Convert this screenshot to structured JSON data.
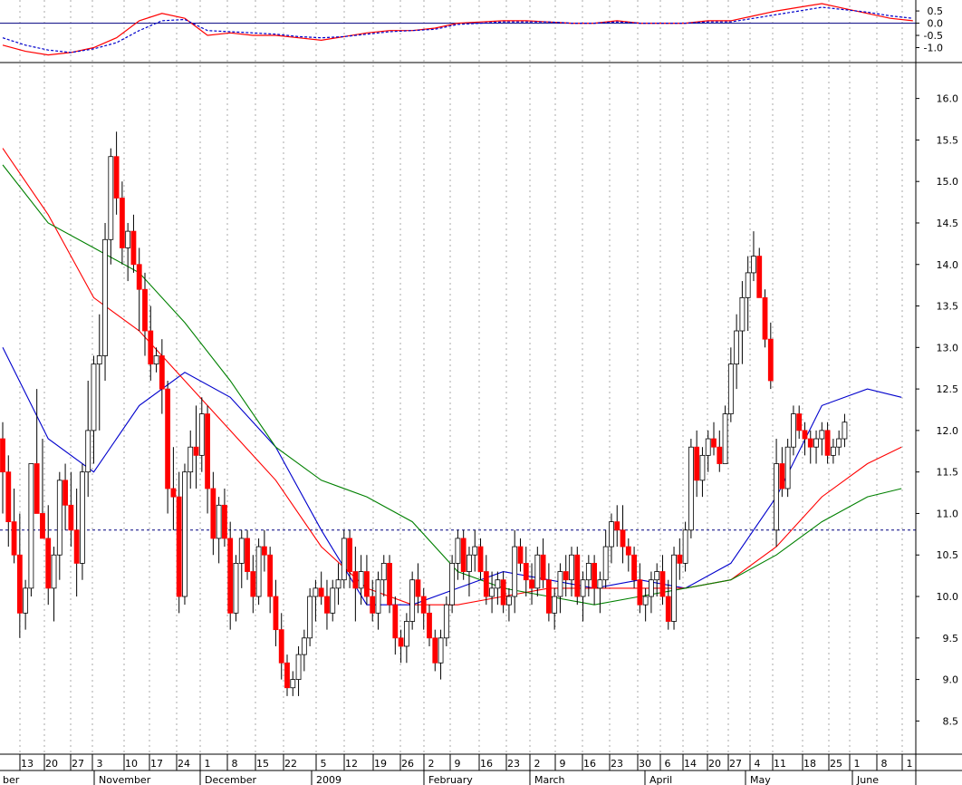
{
  "chart_data": [
    {
      "type": "line",
      "panel": "oscillator",
      "ylim": [
        -1.5,
        0.8
      ],
      "y_ticks": [
        "0.5",
        "0.0",
        "-0.5",
        "-1.0"
      ],
      "zero_line": 0.0,
      "grid": "vertical dotted, one line per week",
      "series": [
        {
          "color": "#ff0000",
          "style": "solid",
          "x": [
            0,
            4,
            8,
            12,
            16,
            20,
            24,
            28,
            32,
            36,
            40,
            44,
            48,
            52,
            56,
            60,
            64,
            68,
            72,
            76,
            80,
            84,
            88,
            92,
            96,
            100,
            104,
            108,
            112,
            116,
            120,
            124,
            128,
            132,
            136,
            140,
            144,
            148,
            152,
            156,
            160
          ],
          "values": [
            -0.9,
            -1.15,
            -1.3,
            -1.2,
            -1.0,
            -0.6,
            0.1,
            0.4,
            0.2,
            -0.5,
            -0.4,
            -0.5,
            -0.5,
            -0.6,
            -0.7,
            -0.55,
            -0.4,
            -0.3,
            -0.3,
            -0.2,
            0.0,
            0.05,
            0.1,
            0.1,
            0.05,
            0.0,
            0.0,
            0.1,
            0.0,
            0.0,
            0.0,
            0.1,
            0.1,
            0.3,
            0.5,
            0.65,
            0.8,
            0.6,
            0.4,
            0.2,
            0.1
          ]
        },
        {
          "color": "#0000cc",
          "style": "dashed",
          "x": [
            0,
            4,
            8,
            12,
            16,
            20,
            24,
            28,
            32,
            36,
            40,
            44,
            48,
            52,
            56,
            60,
            64,
            68,
            72,
            76,
            80,
            84,
            88,
            92,
            96,
            100,
            104,
            108,
            112,
            116,
            120,
            124,
            128,
            132,
            136,
            140,
            144,
            148,
            152,
            156,
            160
          ],
          "values": [
            -0.6,
            -0.9,
            -1.1,
            -1.2,
            -1.05,
            -0.8,
            -0.3,
            0.1,
            0.15,
            -0.3,
            -0.35,
            -0.4,
            -0.45,
            -0.55,
            -0.6,
            -0.55,
            -0.45,
            -0.35,
            -0.3,
            -0.25,
            -0.05,
            0.0,
            0.05,
            0.05,
            0.05,
            0.0,
            0.0,
            0.05,
            0.0,
            0.0,
            0.0,
            0.05,
            0.05,
            0.2,
            0.35,
            0.5,
            0.65,
            0.55,
            0.45,
            0.3,
            0.2
          ]
        }
      ]
    },
    {
      "type": "candlestick",
      "panel": "price",
      "ylim": [
        8.1,
        16.4
      ],
      "y_ticks": [
        "16.0",
        "15.5",
        "15.0",
        "14.5",
        "14.0",
        "13.5",
        "13.0",
        "12.5",
        "12.0",
        "11.5",
        "11.0",
        "10.5",
        "10.0",
        "9.5",
        "9.0",
        "8.5"
      ],
      "reference_line": 10.8,
      "grid": "vertical dotted, one line per week",
      "x_ticks": [
        "13",
        "20",
        "27",
        "3",
        "10",
        "17",
        "24",
        "1",
        "8",
        "15",
        "22",
        "5",
        "12",
        "19",
        "26",
        "2",
        "9",
        "16",
        "23",
        "2",
        "9",
        "16",
        "23",
        "30",
        "6",
        "14",
        "20",
        "27",
        "4",
        "11",
        "18",
        "25",
        "1",
        "8",
        "1"
      ],
      "months": [
        "ber",
        "November",
        "December",
        "2009",
        "February",
        "March",
        "April",
        "May",
        "June"
      ],
      "up_color": "#ffffff",
      "down_color": "#ff0000",
      "candles": [
        [
          11.9,
          12.1,
          11.0,
          11.5
        ],
        [
          11.5,
          11.7,
          10.6,
          10.9
        ],
        [
          10.9,
          11.3,
          10.4,
          10.5
        ],
        [
          10.5,
          11.0,
          9.5,
          9.8
        ],
        [
          9.8,
          10.2,
          9.6,
          10.1
        ],
        [
          10.1,
          11.6,
          10.0,
          11.6
        ],
        [
          11.6,
          12.5,
          11.0,
          11.0
        ],
        [
          11.0,
          11.9,
          10.7,
          10.7
        ],
        [
          10.7,
          11.1,
          9.9,
          10.1
        ],
        [
          10.1,
          10.6,
          9.7,
          10.5
        ],
        [
          10.5,
          11.5,
          10.2,
          11.4
        ],
        [
          11.4,
          11.6,
          10.8,
          11.1
        ],
        [
          11.1,
          11.5,
          10.6,
          10.8
        ],
        [
          10.8,
          11.3,
          10.0,
          10.4
        ],
        [
          10.4,
          11.6,
          10.2,
          11.5
        ],
        [
          11.5,
          12.6,
          11.2,
          12.0
        ],
        [
          12.0,
          12.9,
          11.6,
          12.8
        ],
        [
          12.8,
          13.4,
          12.0,
          12.9
        ],
        [
          12.9,
          14.5,
          12.6,
          14.3
        ],
        [
          14.3,
          15.4,
          14.0,
          15.3
        ],
        [
          15.3,
          15.6,
          14.6,
          14.8
        ],
        [
          14.8,
          15.0,
          14.0,
          14.2
        ],
        [
          14.2,
          14.5,
          13.8,
          14.4
        ],
        [
          14.4,
          14.6,
          13.9,
          14.0
        ],
        [
          14.0,
          14.2,
          13.2,
          13.7
        ],
        [
          13.7,
          13.9,
          12.9,
          13.2
        ],
        [
          13.2,
          13.5,
          12.6,
          12.8
        ],
        [
          12.8,
          13.0,
          12.7,
          12.9
        ],
        [
          12.9,
          13.1,
          12.2,
          12.5
        ],
        [
          12.5,
          12.6,
          11.0,
          11.3
        ],
        [
          11.3,
          11.8,
          10.8,
          11.2
        ],
        [
          11.2,
          11.5,
          9.8,
          10.0
        ],
        [
          10.0,
          11.6,
          9.9,
          11.5
        ],
        [
          11.5,
          12.0,
          11.3,
          11.8
        ],
        [
          11.8,
          12.3,
          11.3,
          11.7
        ],
        [
          11.7,
          12.4,
          11.5,
          12.2
        ],
        [
          12.2,
          12.3,
          11.0,
          11.3
        ],
        [
          11.3,
          11.5,
          10.5,
          10.7
        ],
        [
          10.7,
          11.2,
          10.4,
          11.1
        ],
        [
          11.1,
          11.3,
          10.6,
          10.7
        ],
        [
          10.7,
          10.9,
          9.6,
          9.8
        ],
        [
          9.8,
          10.5,
          9.7,
          10.4
        ],
        [
          10.4,
          10.8,
          10.1,
          10.7
        ],
        [
          10.7,
          10.8,
          10.2,
          10.3
        ],
        [
          10.3,
          10.5,
          9.8,
          10.0
        ],
        [
          10.0,
          10.7,
          9.9,
          10.6
        ],
        [
          10.6,
          10.8,
          10.3,
          10.5
        ],
        [
          10.5,
          10.6,
          9.8,
          10.0
        ],
        [
          10.0,
          10.2,
          9.4,
          9.6
        ],
        [
          9.6,
          9.8,
          9.0,
          9.2
        ],
        [
          9.2,
          9.3,
          8.8,
          8.9
        ],
        [
          8.9,
          9.1,
          8.8,
          9.0
        ],
        [
          9.0,
          9.4,
          8.8,
          9.3
        ],
        [
          9.3,
          9.6,
          9.1,
          9.5
        ],
        [
          9.5,
          10.1,
          9.4,
          10.0
        ],
        [
          10.0,
          10.2,
          9.7,
          10.1
        ],
        [
          10.1,
          10.3,
          9.9,
          10.0
        ],
        [
          10.0,
          10.2,
          9.6,
          9.8
        ],
        [
          9.8,
          10.2,
          9.7,
          10.1
        ],
        [
          10.1,
          10.4,
          9.9,
          10.2
        ],
        [
          10.2,
          10.8,
          10.1,
          10.7
        ],
        [
          10.7,
          10.8,
          10.1,
          10.3
        ],
        [
          10.3,
          10.6,
          9.7,
          10.1
        ],
        [
          10.1,
          10.5,
          9.9,
          10.3
        ],
        [
          10.3,
          10.5,
          9.9,
          10.0
        ],
        [
          10.0,
          10.2,
          9.7,
          9.8
        ],
        [
          9.8,
          10.3,
          9.6,
          10.2
        ],
        [
          10.2,
          10.5,
          10.0,
          10.4
        ],
        [
          10.4,
          10.5,
          9.8,
          9.9
        ],
        [
          9.9,
          10.0,
          9.3,
          9.5
        ],
        [
          9.5,
          9.6,
          9.2,
          9.4
        ],
        [
          9.4,
          9.8,
          9.2,
          9.7
        ],
        [
          9.7,
          10.3,
          9.6,
          10.2
        ],
        [
          10.2,
          10.4,
          9.8,
          10.0
        ],
        [
          10.0,
          10.1,
          9.6,
          9.8
        ],
        [
          9.8,
          9.9,
          9.4,
          9.5
        ],
        [
          9.5,
          9.6,
          9.1,
          9.2
        ],
        [
          9.2,
          9.6,
          9.0,
          9.5
        ],
        [
          9.5,
          10.0,
          9.4,
          9.9
        ],
        [
          9.9,
          10.5,
          9.8,
          10.4
        ],
        [
          10.4,
          10.8,
          10.2,
          10.7
        ],
        [
          10.7,
          10.8,
          10.2,
          10.3
        ],
        [
          10.3,
          10.6,
          10.0,
          10.5
        ],
        [
          10.5,
          10.8,
          10.3,
          10.6
        ],
        [
          10.6,
          10.7,
          10.2,
          10.3
        ],
        [
          10.3,
          10.5,
          9.9,
          10.0
        ],
        [
          10.0,
          10.3,
          9.8,
          10.1
        ],
        [
          10.1,
          10.3,
          9.9,
          10.2
        ],
        [
          10.2,
          10.3,
          9.8,
          9.9
        ],
        [
          9.9,
          10.1,
          9.7,
          10.0
        ],
        [
          10.0,
          10.8,
          9.8,
          10.6
        ],
        [
          10.6,
          10.7,
          10.3,
          10.4
        ],
        [
          10.4,
          10.6,
          10.0,
          10.2
        ],
        [
          10.2,
          10.4,
          9.9,
          10.1
        ],
        [
          10.1,
          10.6,
          10.0,
          10.5
        ],
        [
          10.5,
          10.7,
          10.1,
          10.2
        ],
        [
          10.2,
          10.4,
          9.7,
          9.8
        ],
        [
          9.8,
          10.1,
          9.6,
          10.0
        ],
        [
          10.0,
          10.4,
          9.8,
          10.3
        ],
        [
          10.3,
          10.5,
          10.0,
          10.2
        ],
        [
          10.2,
          10.6,
          10.0,
          10.5
        ],
        [
          10.5,
          10.6,
          9.9,
          10.0
        ],
        [
          10.0,
          10.3,
          9.7,
          10.2
        ],
        [
          10.2,
          10.5,
          10.0,
          10.4
        ],
        [
          10.4,
          10.5,
          9.9,
          10.1
        ],
        [
          10.1,
          10.3,
          9.8,
          10.2
        ],
        [
          10.2,
          10.8,
          10.1,
          10.6
        ],
        [
          10.6,
          11.0,
          10.4,
          10.9
        ],
        [
          10.9,
          11.1,
          10.6,
          10.8
        ],
        [
          10.8,
          11.1,
          10.4,
          10.6
        ],
        [
          10.6,
          10.7,
          10.3,
          10.5
        ],
        [
          10.5,
          10.6,
          10.1,
          10.2
        ],
        [
          10.2,
          10.4,
          9.8,
          9.9
        ],
        [
          9.9,
          10.1,
          9.7,
          10.0
        ],
        [
          10.0,
          10.3,
          9.8,
          10.2
        ],
        [
          10.2,
          10.4,
          10.0,
          10.3
        ],
        [
          10.3,
          10.5,
          9.9,
          10.0
        ],
        [
          10.0,
          10.2,
          9.6,
          9.7
        ],
        [
          9.7,
          10.6,
          9.6,
          10.5
        ],
        [
          10.5,
          10.7,
          10.2,
          10.4
        ],
        [
          10.4,
          10.9,
          10.3,
          10.8
        ],
        [
          10.8,
          11.9,
          10.7,
          11.8
        ],
        [
          11.8,
          12.0,
          11.2,
          11.4
        ],
        [
          11.4,
          11.8,
          11.2,
          11.7
        ],
        [
          11.7,
          12.0,
          11.5,
          11.9
        ],
        [
          11.9,
          12.1,
          11.7,
          11.8
        ],
        [
          11.8,
          12.0,
          11.5,
          11.6
        ],
        [
          11.6,
          12.3,
          11.6,
          12.2
        ],
        [
          12.2,
          13.0,
          12.1,
          12.8
        ],
        [
          12.8,
          13.4,
          12.5,
          13.2
        ],
        [
          13.2,
          13.8,
          12.8,
          13.6
        ],
        [
          13.6,
          14.1,
          13.2,
          13.9
        ],
        [
          13.9,
          14.4,
          13.8,
          14.1
        ],
        [
          14.1,
          14.2,
          13.6,
          13.6
        ],
        [
          13.6,
          13.7,
          13.0,
          13.1
        ],
        [
          13.1,
          13.3,
          12.5,
          12.6
        ],
        [
          10.8,
          11.9,
          10.6,
          11.6
        ],
        [
          11.6,
          11.8,
          11.2,
          11.3
        ],
        [
          11.3,
          11.9,
          11.2,
          11.8
        ],
        [
          11.8,
          12.3,
          11.7,
          12.2
        ],
        [
          12.2,
          12.3,
          11.9,
          12.0
        ],
        [
          12.0,
          12.1,
          11.7,
          11.9
        ],
        [
          11.9,
          12.0,
          11.6,
          11.8
        ],
        [
          11.8,
          12.0,
          11.6,
          11.9
        ],
        [
          11.9,
          12.1,
          11.7,
          12.0
        ],
        [
          12.0,
          12.1,
          11.6,
          11.7
        ],
        [
          11.7,
          11.9,
          11.6,
          11.8
        ],
        [
          11.8,
          12.0,
          11.7,
          11.9
        ],
        [
          11.9,
          12.2,
          11.8,
          12.1
        ]
      ],
      "moving_averages": [
        {
          "color": "#0000cc",
          "x": [
            0,
            8,
            16,
            24,
            32,
            40,
            48,
            56,
            64,
            72,
            80,
            88,
            96,
            104,
            112,
            120,
            128,
            136,
            144,
            152,
            158
          ],
          "values": [
            13.0,
            11.9,
            11.5,
            12.3,
            12.7,
            12.4,
            11.8,
            10.8,
            9.9,
            9.9,
            10.1,
            10.3,
            10.2,
            10.1,
            10.2,
            10.1,
            10.4,
            11.2,
            12.3,
            12.5,
            12.4
          ]
        },
        {
          "color": "#ff0000",
          "x": [
            0,
            8,
            16,
            24,
            32,
            40,
            48,
            56,
            64,
            72,
            80,
            88,
            96,
            104,
            112,
            120,
            128,
            136,
            144,
            152,
            158
          ],
          "values": [
            15.4,
            14.6,
            13.6,
            13.2,
            12.6,
            12.0,
            11.4,
            10.6,
            10.1,
            9.9,
            9.9,
            10.0,
            10.1,
            10.1,
            10.1,
            10.1,
            10.2,
            10.6,
            11.2,
            11.6,
            11.8
          ]
        },
        {
          "color": "#008000",
          "x": [
            0,
            8,
            16,
            24,
            32,
            40,
            48,
            56,
            64,
            72,
            80,
            88,
            96,
            104,
            112,
            120,
            128,
            136,
            144,
            152,
            158
          ],
          "values": [
            15.2,
            14.5,
            14.2,
            13.9,
            13.3,
            12.6,
            11.8,
            11.4,
            11.2,
            10.9,
            10.3,
            10.1,
            10.0,
            9.9,
            10.0,
            10.1,
            10.2,
            10.5,
            10.9,
            11.2,
            11.3
          ]
        }
      ]
    }
  ]
}
